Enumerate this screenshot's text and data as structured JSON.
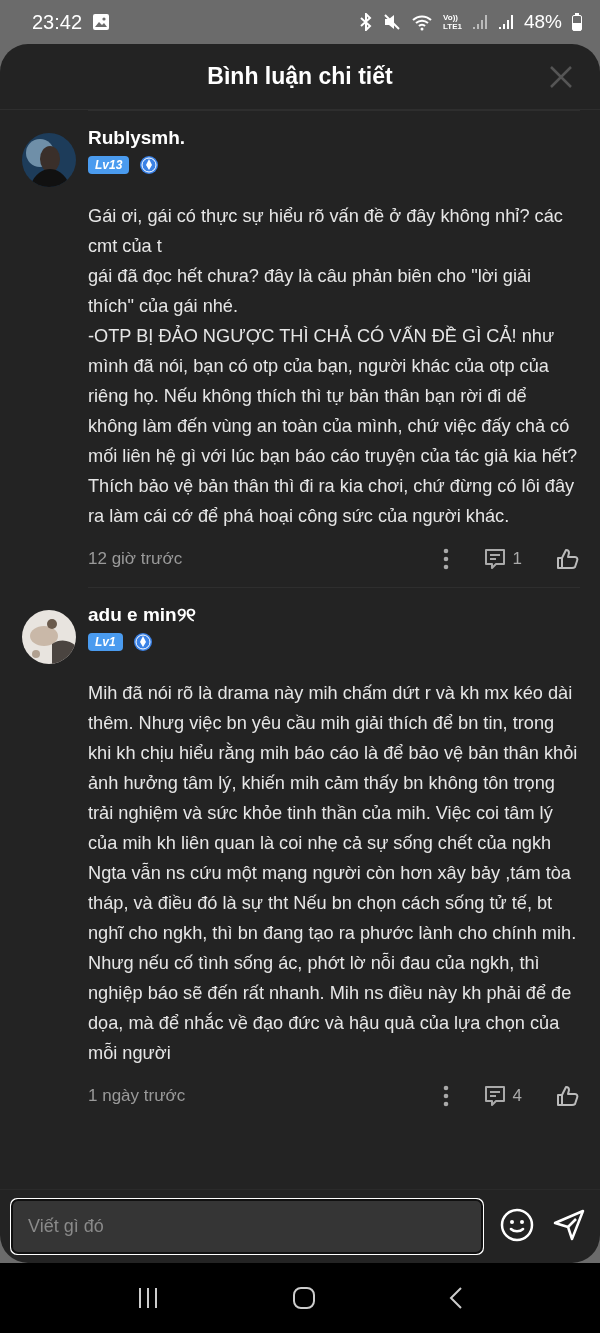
{
  "status_bar": {
    "time": "23:42",
    "battery": "48%",
    "network_label": "Vo))\nLTE1"
  },
  "sheet": {
    "title": "Bình luận chi tiết"
  },
  "comments": [
    {
      "author": "Rublysmh.",
      "level_badge": "Lv13",
      "text": "Gái ơi, gái có thực sự hiểu rõ vấn đề ở đây không nhỉ? các cmt của t\ngái đã đọc hết chưa? đây là câu phản biên cho \"lời giải thích\" của gái nhé.\n-OTP BỊ ĐẢO NGƯỢC THÌ CHẢ CÓ VẤN ĐỀ GÌ CẢ! như mình đã nói, bạn có otp của bạn, người khác của otp của riêng họ. Nếu không thích thì tự bản thân bạn rời đi dể không làm đến vùng an toàn của mình, chứ việc đấy chả có mối liên hệ gì với lúc bạn báo cáo truyện của tác giả kia hết? Thích bảo vệ bản thân thì đi ra kia chơi, chứ đừng có lôi đây ra làm cái cớ để phá hoại công sức của người khác.",
      "time": "12 giờ trước",
      "reply_count": "1"
    },
    {
      "author": "adu e min୨୧",
      "level_badge": "Lv1",
      "text": "Mih đã nói rõ là drama này mih chấm dứt r và kh mx kéo dài thêm. Nhưg việc bn yêu cầu mih giải thích để bn tin, trong khi kh chịu hiểu rằng mih báo cáo là để bảo vệ bản thân khỏi ảnh hưởng tâm lý, khiến mih cảm thấy bn không tôn trọng trải nghiệm và sức khỏe tinh thần của mih. Việc coi tâm lý của mih kh liên quan là coi nhẹ cả sự sống chết của ngkh\nNgta vẫn ns cứu một mạng người còn hơn xây bảy ,tám tòa tháp, và điều đó là sự tht Nếu bn chọn cách sống tử tế, bt nghĩ cho ngkh, thì bn đang tạo ra phước lành cho chính mih. Nhưg nếu cố tình sống ác, phớt lờ nỗi đau của ngkh, thì nghiệp báo sẽ đến rất nhanh. Mih ns điều này kh phải để đe dọa, mà để nhắc về đạo đức và hậu quả của lựa chọn của mỗi người",
      "time": "1 ngày trước",
      "reply_count": "4"
    }
  ],
  "composer": {
    "placeholder": "Viết gì đó"
  }
}
